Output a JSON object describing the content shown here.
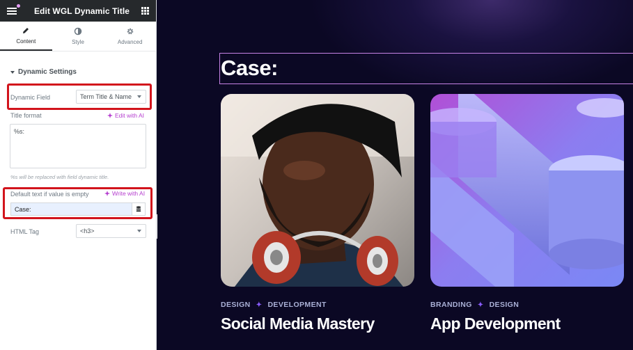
{
  "panel": {
    "title": "Edit WGL Dynamic Title",
    "tabs": [
      {
        "label": "Content",
        "icon": "pencil-icon",
        "active": true
      },
      {
        "label": "Style",
        "icon": "contrast-icon",
        "active": false
      },
      {
        "label": "Advanced",
        "icon": "gear-icon",
        "active": false
      }
    ],
    "section_title": "Dynamic Settings",
    "dynamic_field": {
      "label": "Dynamic Field",
      "value": "Term Title & Name"
    },
    "title_format": {
      "label": "Title format",
      "ai_link": "Edit with AI",
      "value": "%s:"
    },
    "hint": "%s will be replaced with field dynamic title.",
    "default_text": {
      "label": "Default text if value is empty",
      "ai_link": "Write with AI",
      "value": "Case:"
    },
    "html_tag": {
      "label": "HTML Tag",
      "value": "<h3>"
    }
  },
  "canvas": {
    "heading": "Case:",
    "cards": [
      {
        "tags": [
          "DESIGN",
          "DEVELOPMENT"
        ],
        "title": "Social Media Mastery"
      },
      {
        "tags": [
          "BRANDING",
          "DESIGN"
        ],
        "title": "App Development"
      }
    ]
  },
  "colors": {
    "accent": "#b53ecf",
    "highlight": "#d2141c",
    "canvas_bg": "#0b0824",
    "tag_separator": "#8a5cff"
  }
}
